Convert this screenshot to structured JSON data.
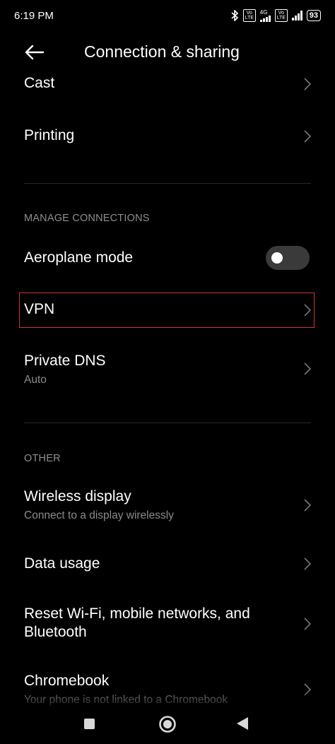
{
  "status_bar": {
    "time": "6:19 PM",
    "network_type": "4G",
    "volte_label": "Vo LTE",
    "battery": "93"
  },
  "header": {
    "title": "Connection & sharing",
    "back_icon": "arrow-left-icon"
  },
  "items_top": [
    {
      "title": "Cast"
    },
    {
      "title": "Printing"
    }
  ],
  "manage_connections": {
    "header": "MANAGE CONNECTIONS",
    "aeroplane": {
      "title": "Aeroplane mode",
      "toggle_on": false
    },
    "vpn": {
      "title": "VPN"
    },
    "private_dns": {
      "title": "Private DNS",
      "subtitle": "Auto"
    }
  },
  "other": {
    "header": "OTHER",
    "wireless_display": {
      "title": "Wireless display",
      "subtitle": "Connect to a display wirelessly"
    },
    "data_usage": {
      "title": "Data usage"
    },
    "reset": {
      "title_line1": "Reset Wi-Fi, mobile networks, and",
      "title_line2": "Bluetooth"
    },
    "chromebook": {
      "title": "Chromebook",
      "subtitle": "Your phone is not linked to a Chromebook"
    }
  },
  "colors": {
    "background": "#000000",
    "text_primary": "#ffffff",
    "text_secondary": "#8a8a8a",
    "highlight": "#d0333a"
  }
}
